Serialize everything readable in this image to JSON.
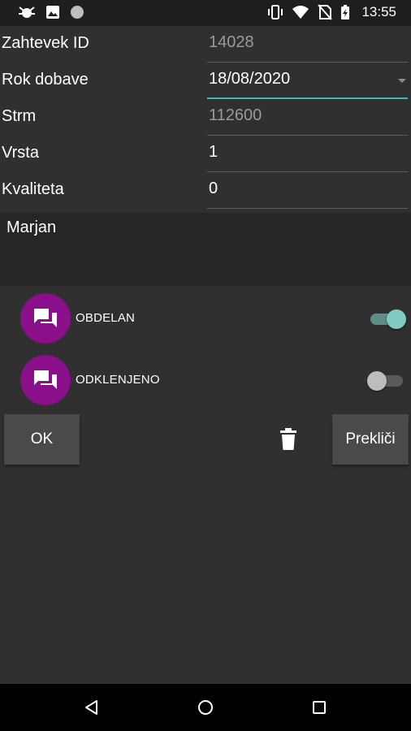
{
  "status_bar": {
    "time": "13:55",
    "left_icons": [
      "bug-icon",
      "image-icon",
      "circle-icon"
    ],
    "right_icons": [
      "vibrate-icon",
      "wifi-icon",
      "no-sim-icon",
      "battery-charging-icon"
    ]
  },
  "form": {
    "request_id": {
      "label": "Zahtevek ID",
      "value": "14028"
    },
    "delivery_date": {
      "label": "Rok dobave",
      "value": "18/08/2020"
    },
    "customer": {
      "label": "Strm",
      "value": "112600"
    },
    "row": {
      "label": "Vrsta",
      "value": "1"
    },
    "quality": {
      "label": "Kvaliteta",
      "value": "0"
    },
    "notes": {
      "value": "Marjan"
    }
  },
  "toggles": [
    {
      "label": "OBDELAN",
      "checked": true,
      "icon": "chat-bubbles-icon"
    },
    {
      "label": "ODKLENJENO",
      "checked": false,
      "icon": "chat-bubbles-icon"
    }
  ],
  "actions": {
    "ok_label": "OK",
    "delete_icon": "trash-icon",
    "cancel_label": "Prekliči"
  },
  "nav_bar": {
    "icons": [
      "back-icon",
      "home-icon",
      "recents-icon"
    ]
  },
  "colors": {
    "background": "#303030",
    "accent": "#4db6ac",
    "avatar": "#8a0f8a",
    "status_bar": "#1e1e1e"
  }
}
